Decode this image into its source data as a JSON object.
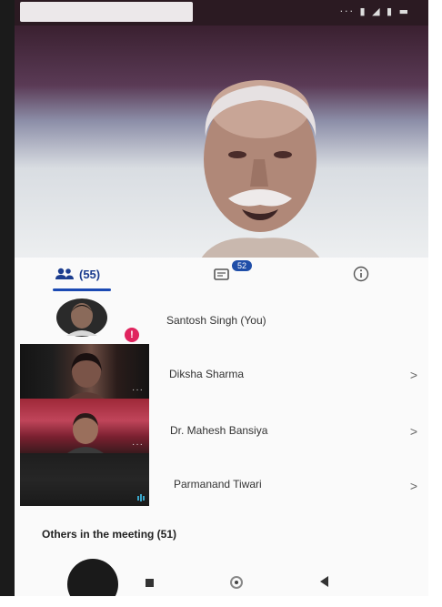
{
  "status_bar": {
    "icons": "··· ▮ ◢ ▮ ▬"
  },
  "tabs": {
    "people": {
      "label": "(55)",
      "icon": "people-icon"
    },
    "chat": {
      "badge": "52",
      "icon": "chat-icon"
    },
    "info": {
      "icon": "info-icon"
    }
  },
  "participants": [
    {
      "name": "Santosh Singh (You)",
      "icon": "avatar"
    },
    {
      "name": "Diksha Sharma",
      "icon": "chevron-right-icon",
      "chevron": ">"
    },
    {
      "name": "Dr. Mahesh Bansiya",
      "icon": "chevron-right-icon",
      "chevron": ">"
    },
    {
      "name": "Parmanand Tiwari",
      "icon": "chevron-right-icon",
      "chevron": ">"
    }
  ],
  "thumb_more": "···",
  "others_label": "Others in the meeting (51)",
  "colors": {
    "accent": "#1a49b3",
    "alert": "#e0245e"
  }
}
